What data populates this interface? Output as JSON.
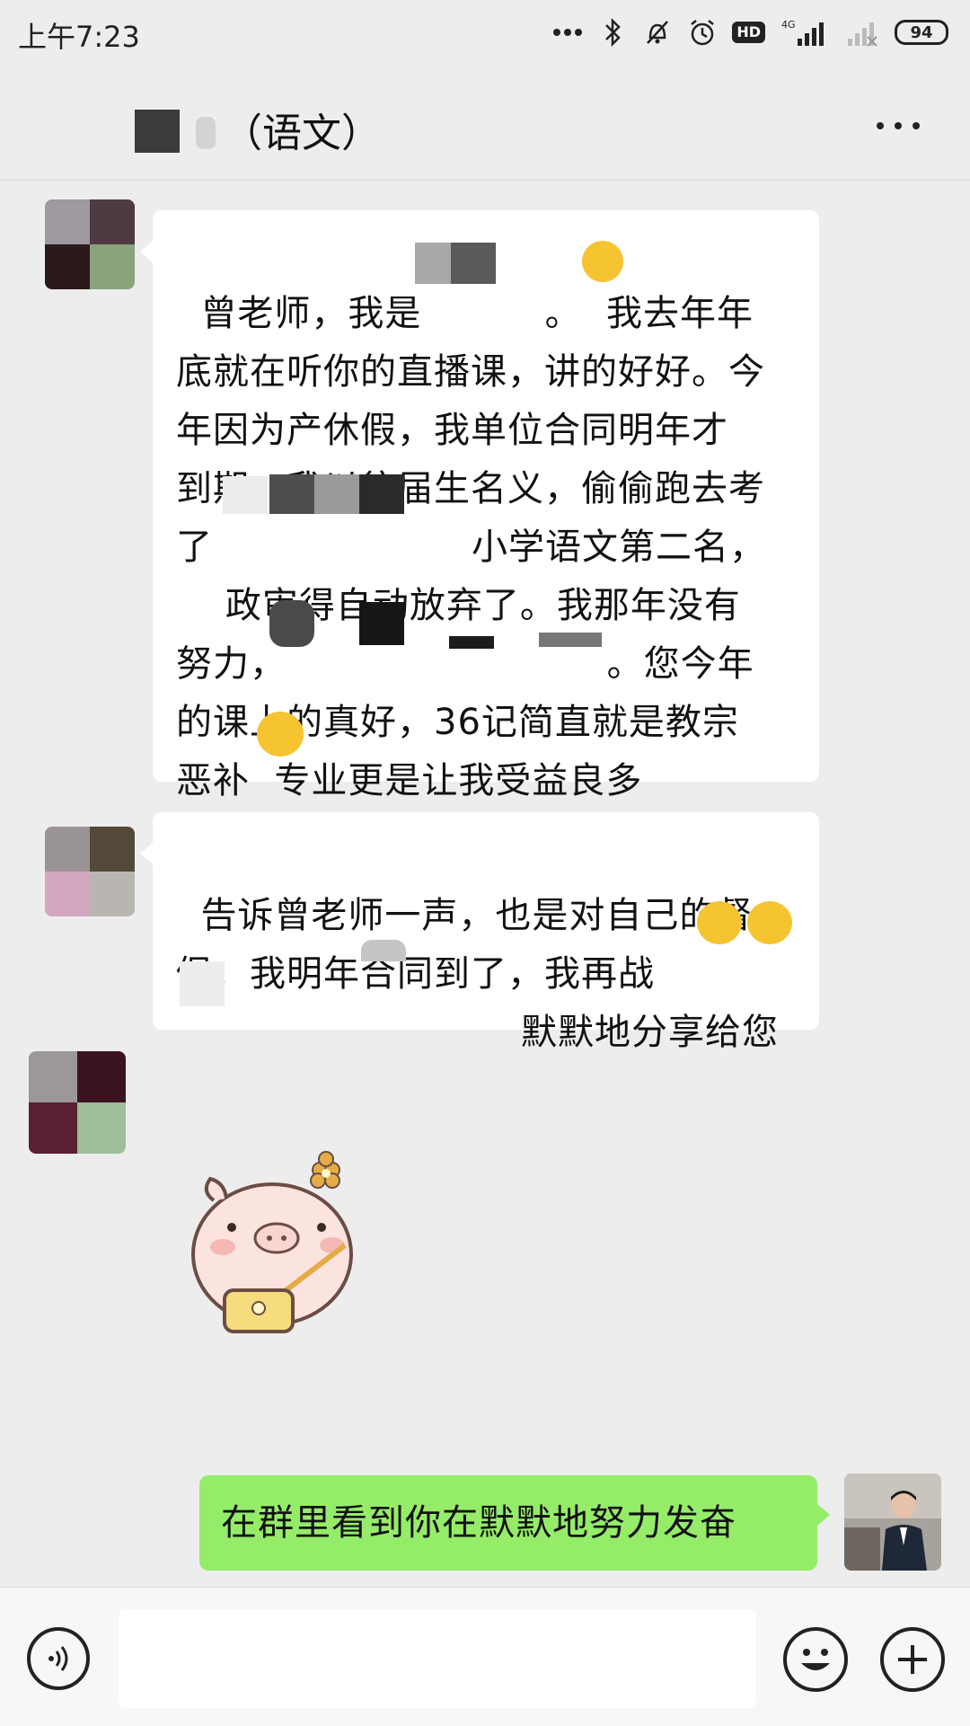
{
  "status_bar": {
    "time": "上午7:23",
    "battery": "94",
    "network": "4G",
    "hd": "HD"
  },
  "header": {
    "title": "（语文）"
  },
  "messages": [
    {
      "sender": "other",
      "text": "曾老师，我是          。  我去年年\n底就在听你的直播课，讲的好好。今\n年因为产休假，我单位合同明年才\n到期，我以往届生名义，偷偷跑去考\n了                     小学语文第二名，\n    政审得自动放弃了。我那年没有\n努力，                          。您今年\n的课上的真好，36记简直就是教宗\n恶补  专业更是让我受益良多"
    },
    {
      "sender": "other",
      "text": "告诉曾老师一声，也是对自己的督\n促，我明年合同到了，我再战  \n                            默默地分享给您"
    },
    {
      "sender": "other",
      "type": "sticker",
      "sticker": "pig-with-bag"
    },
    {
      "sender": "me",
      "text": "在群里看到你在默默地努力发奋"
    }
  ],
  "input": {
    "placeholder": ""
  },
  "colors": {
    "background": "#ededed",
    "bubble_other": "#ffffff",
    "bubble_me": "#95ec69"
  }
}
